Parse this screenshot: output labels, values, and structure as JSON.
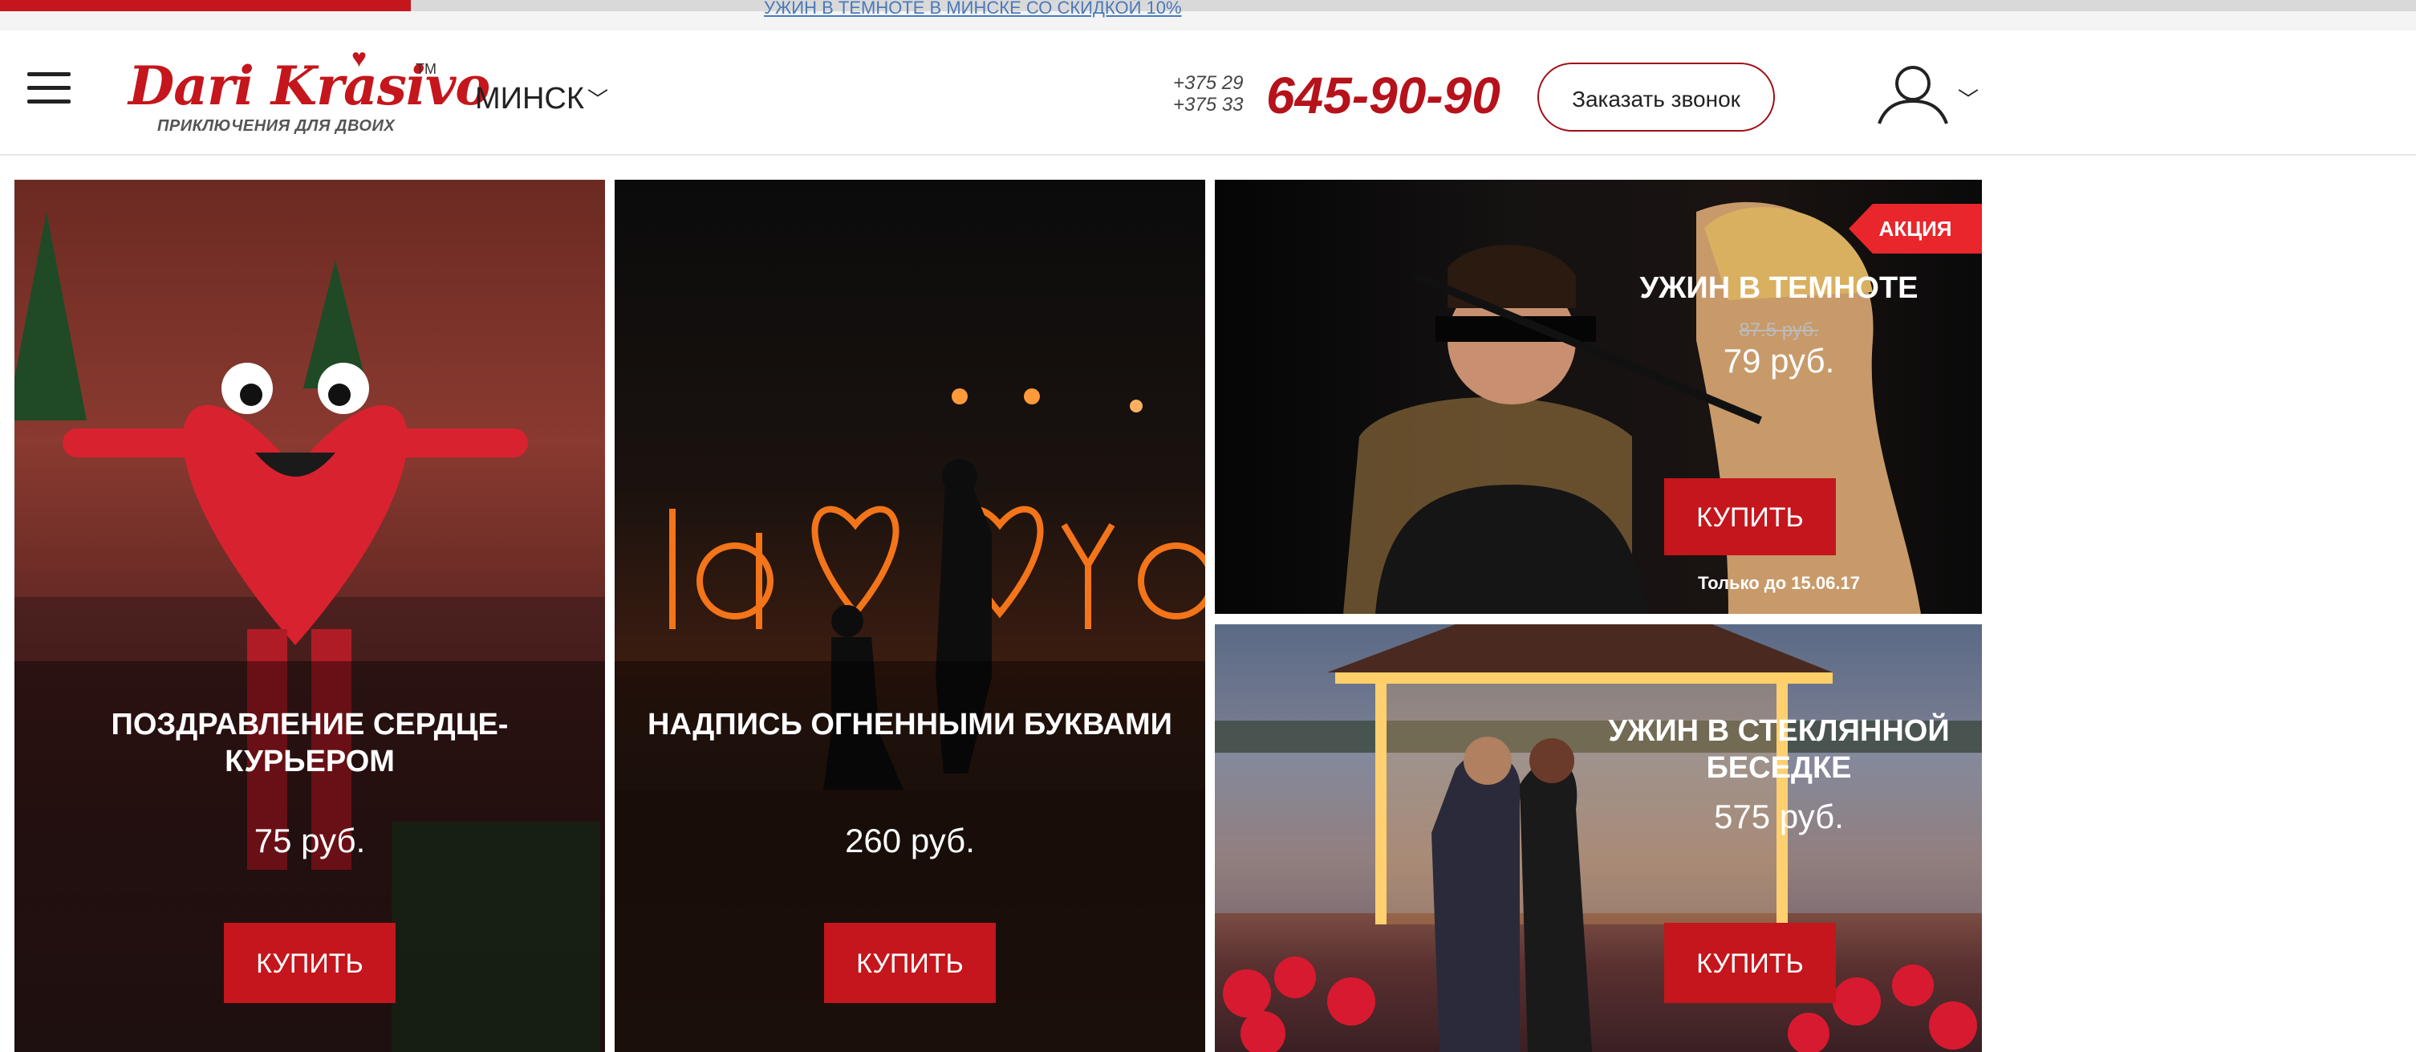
{
  "top_strip": {
    "promo_link": "УЖИН В ТЕМНОТЕ В МИНСКЕ СО СКИДКОЙ 10%"
  },
  "header": {
    "logo_text": "Dari Krasivo",
    "logo_tm": "TM",
    "logo_tagline": "ПРИКЛЮЧЕНИЯ ДЛЯ ДВОИХ",
    "city": "МИНСК",
    "phone_codes": [
      "+375 29",
      "+375 33"
    ],
    "phone_number": "645-90-90",
    "callback_button": "Заказать звонок"
  },
  "products": [
    {
      "title": "ПОЗДРАВЛЕНИЕ СЕРДЦЕ-КУРЬЕРОМ",
      "price": "75 руб.",
      "buy_label": "КУПИТЬ"
    },
    {
      "title": "НАДПИСЬ ОГНЕННЫМИ БУКВАМИ",
      "price": "260 руб.",
      "buy_label": "КУПИТЬ"
    },
    {
      "title": "УЖИН В ТЕМНОТЕ",
      "old_price": "87.5 руб.",
      "price": "79 руб.",
      "buy_label": "КУПИТЬ",
      "badge": "АКЦИЯ",
      "until": "Только до 15.06.17"
    },
    {
      "title": "УЖИН В СТЕКЛЯННОЙ БЕСЕДКЕ",
      "price": "575 руб.",
      "buy_label": "КУПИТЬ"
    }
  ],
  "icons": {
    "menu": "hamburger-icon",
    "city_chevron": "chevron-down-icon",
    "user": "user-icon",
    "user_chevron": "chevron-down-icon",
    "logo_heart": "heart-icon"
  },
  "colors": {
    "brand_red": "#c4161c",
    "badge_red": "#e8262b",
    "phone_red": "#b5121b"
  }
}
